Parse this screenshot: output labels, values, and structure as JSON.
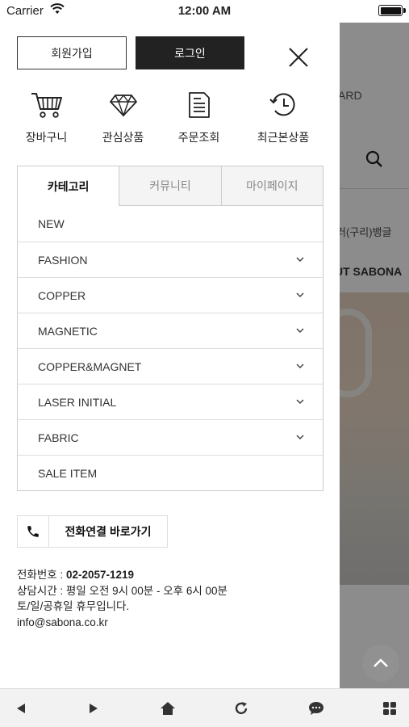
{
  "status_bar": {
    "carrier": "Carrier",
    "time": "12:00 AM"
  },
  "drawer": {
    "join_label": "회원가입",
    "login_label": "로그인",
    "quick_links": [
      {
        "label": "장바구니",
        "icon": "cart-icon"
      },
      {
        "label": "관심상품",
        "icon": "diamond-icon"
      },
      {
        "label": "주문조회",
        "icon": "document-icon"
      },
      {
        "label": "최근본상품",
        "icon": "history-icon"
      }
    ],
    "tabs": [
      {
        "label": "카테고리",
        "active": true
      },
      {
        "label": "커뮤니티",
        "active": false
      },
      {
        "label": "마이페이지",
        "active": false
      }
    ],
    "categories": [
      {
        "label": "NEW",
        "expandable": false
      },
      {
        "label": "FASHION",
        "expandable": true
      },
      {
        "label": "COPPER",
        "expandable": true
      },
      {
        "label": "MAGNETIC",
        "expandable": true
      },
      {
        "label": "COPPER&MAGNET",
        "expandable": true
      },
      {
        "label": "LASER INITIAL",
        "expandable": true
      },
      {
        "label": "FABRIC",
        "expandable": true
      },
      {
        "label": "SALE ITEM",
        "expandable": false
      }
    ],
    "call_label": "전화연결 바로가기",
    "contact": {
      "phone_label": "전화번호 : ",
      "phone": "02-2057-1219",
      "hours": "상담시간 : 평일 오전 9시 00분 - 오후 6시 00분",
      "holiday": "토/일/공휴일 휴무입니다.",
      "email": "info@sabona.co.kr"
    }
  },
  "background_page": {
    "board_text": "ARD",
    "product_text": "러(구리)뱅글",
    "about_text": "UT SABONA"
  },
  "toolbar": {
    "icons": [
      "back-icon",
      "forward-icon",
      "home-icon",
      "refresh-icon",
      "chat-icon",
      "grid-icon"
    ]
  },
  "colors": {
    "login_bg": "#222222",
    "dim_overlay": "rgba(0,0,0,0.45)"
  }
}
